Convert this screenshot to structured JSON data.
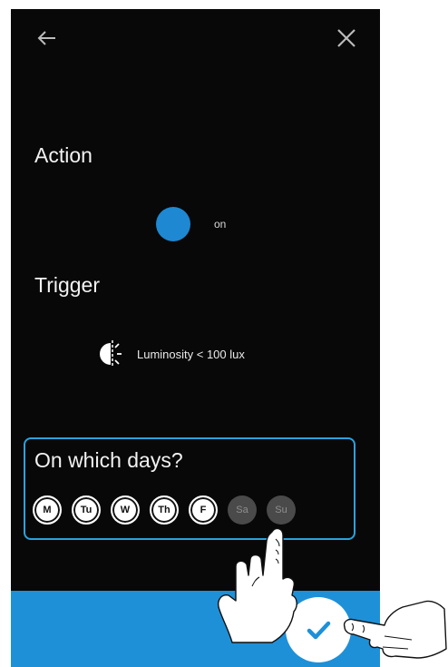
{
  "action": {
    "title": "Action",
    "state_label": "on",
    "indicator_color": "#1e88d2"
  },
  "trigger": {
    "title": "Trigger",
    "text": "Luminosity < 100 lux",
    "icon": "luminosity-icon"
  },
  "days": {
    "title": "On which days?",
    "items": [
      {
        "label": "M",
        "selected": true
      },
      {
        "label": "Tu",
        "selected": true
      },
      {
        "label": "W",
        "selected": true
      },
      {
        "label": "Th",
        "selected": true
      },
      {
        "label": "F",
        "selected": true
      },
      {
        "label": "Sa",
        "selected": false
      },
      {
        "label": "Su",
        "selected": false
      }
    ]
  },
  "toolbar": {
    "back_icon": "arrow-left-icon",
    "close_icon": "close-icon",
    "confirm_icon": "checkmark-icon"
  },
  "colors": {
    "accent": "#1e90d8",
    "background": "#080808",
    "highlight_border": "#29a3dd"
  }
}
